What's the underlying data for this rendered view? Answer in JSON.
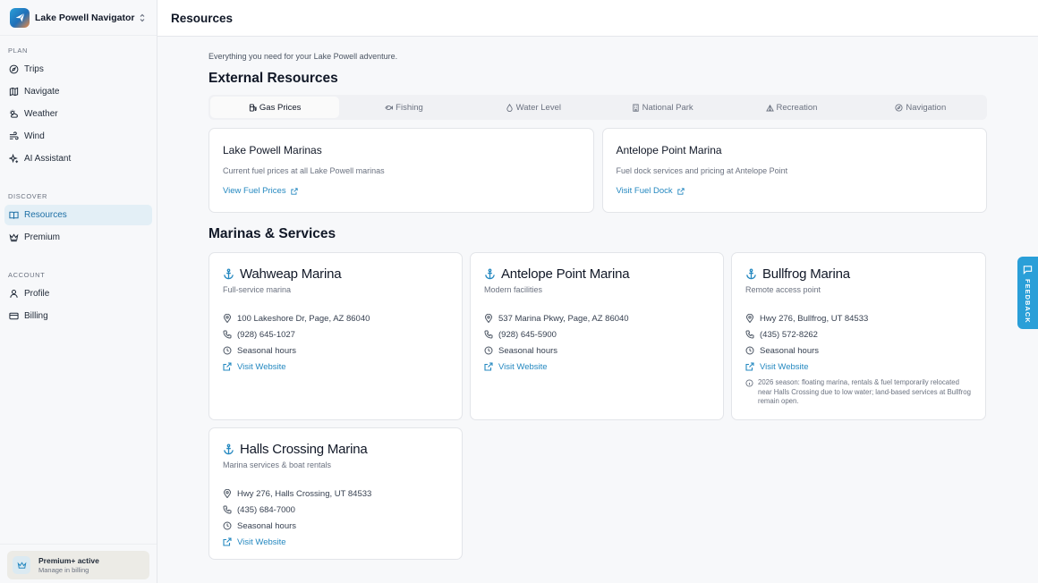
{
  "app": {
    "name": "Lake Powell Navigator"
  },
  "sidebar": {
    "sections": [
      {
        "label": "PLAN",
        "items": [
          {
            "label": "Trips",
            "icon": "compass-icon"
          },
          {
            "label": "Navigate",
            "icon": "map-icon"
          },
          {
            "label": "Weather",
            "icon": "sun-cloud-icon"
          },
          {
            "label": "Wind",
            "icon": "wind-icon"
          },
          {
            "label": "AI Assistant",
            "icon": "sparkle-icon"
          }
        ]
      },
      {
        "label": "DISCOVER",
        "items": [
          {
            "label": "Resources",
            "icon": "book-icon",
            "active": true
          },
          {
            "label": "Premium",
            "icon": "crown-icon"
          }
        ]
      },
      {
        "label": "ACCOUNT",
        "items": [
          {
            "label": "Profile",
            "icon": "user-icon"
          },
          {
            "label": "Billing",
            "icon": "credit-card-icon"
          }
        ]
      }
    ],
    "premium": {
      "title": "Premium+ active",
      "subtitle": "Manage in billing"
    }
  },
  "header": {
    "title": "Resources"
  },
  "intro": "Everything you need for your Lake Powell adventure.",
  "external": {
    "heading": "External Resources",
    "tabs": [
      {
        "label": "Gas Prices",
        "icon": "fuel-icon",
        "active": true
      },
      {
        "label": "Fishing",
        "icon": "fish-icon"
      },
      {
        "label": "Water Level",
        "icon": "droplet-icon"
      },
      {
        "label": "National Park",
        "icon": "building-icon"
      },
      {
        "label": "Recreation",
        "icon": "tent-icon"
      },
      {
        "label": "Navigation",
        "icon": "compass-icon"
      }
    ],
    "cards": [
      {
        "title": "Lake Powell Marinas",
        "description": "Current fuel prices at all Lake Powell marinas",
        "link": "View Fuel Prices"
      },
      {
        "title": "Antelope Point Marina",
        "description": "Fuel dock services and pricing at Antelope Point",
        "link": "Visit Fuel Dock"
      }
    ]
  },
  "marinas": {
    "heading": "Marinas & Services",
    "items": [
      {
        "name": "Wahweap Marina",
        "subtitle": "Full-service marina",
        "address": "100 Lakeshore Dr, Page, AZ 86040",
        "phone": "(928) 645-1027",
        "hours": "Seasonal hours",
        "website": "Visit Website"
      },
      {
        "name": "Antelope Point Marina",
        "subtitle": "Modern facilities",
        "address": "537 Marina Pkwy, Page, AZ 86040",
        "phone": "(928) 645-5900",
        "hours": "Seasonal hours",
        "website": "Visit Website"
      },
      {
        "name": "Bullfrog Marina",
        "subtitle": "Remote access point",
        "address": "Hwy 276, Bullfrog, UT 84533",
        "phone": "(435) 572-8262",
        "hours": "Seasonal hours",
        "website": "Visit Website",
        "note": "2026 season: floating marina, rentals & fuel temporarily relocated near Halls Crossing due to low water; land-based services at Bullfrog remain open."
      },
      {
        "name": "Halls Crossing Marina",
        "subtitle": "Marina services & boat rentals",
        "address": "Hwy 276, Halls Crossing, UT 84533",
        "phone": "(435) 684-7000",
        "hours": "Seasonal hours",
        "website": "Visit Website"
      }
    ]
  },
  "feedback": {
    "label": "FEEDBACK"
  },
  "colors": {
    "accent": "#2488c0",
    "feedback": "#2a9fd8",
    "active_nav_bg": "#e3eff6"
  }
}
